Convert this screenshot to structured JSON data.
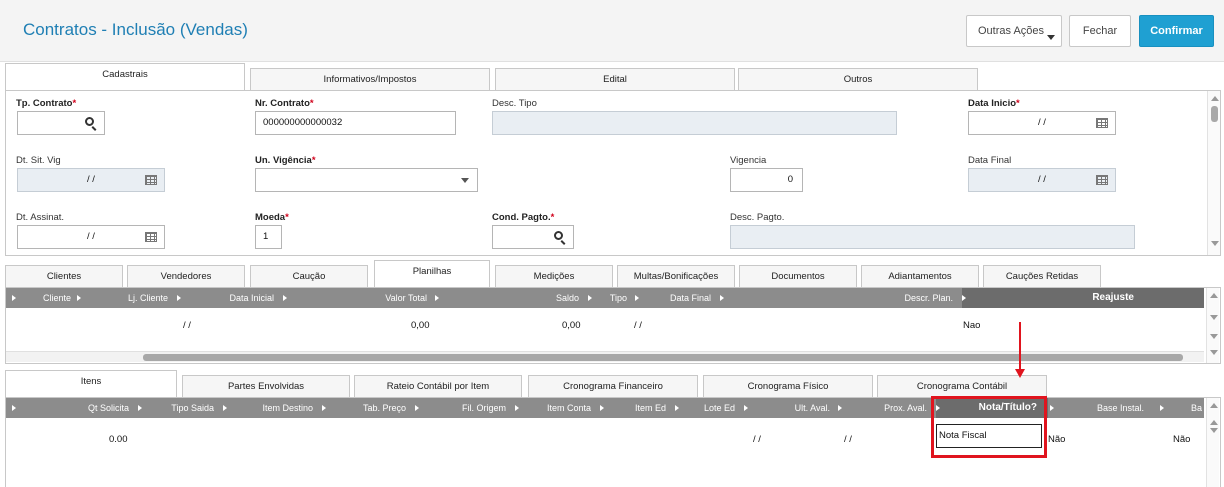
{
  "header": {
    "title": "Contratos - Inclusão (Vendas)",
    "buttons": {
      "outras": "Outras Ações",
      "fechar": "Fechar",
      "confirmar": "Confirmar"
    }
  },
  "top_tabs": [
    "Cadastrais",
    "Informativos/Impostos",
    "Edital",
    "Outros"
  ],
  "form": {
    "tp_contrato": {
      "label": "Tp. Contrato",
      "value": ""
    },
    "nr_contrato": {
      "label": "Nr. Contrato",
      "value": "000000000000032"
    },
    "desc_tipo": {
      "label": "Desc. Tipo",
      "value": ""
    },
    "data_inicio": {
      "label": "Data Inicio",
      "value": "/ /"
    },
    "dt_sit_vig": {
      "label": "Dt. Sit. Vig",
      "value": "/ /"
    },
    "un_vigencia": {
      "label": "Un. Vigência",
      "value": ""
    },
    "vigencia": {
      "label": "Vigencia",
      "value": "0"
    },
    "data_final": {
      "label": "Data Final",
      "value": "/ /"
    },
    "dt_assinat": {
      "label": "Dt. Assinat.",
      "value": "/ /"
    },
    "moeda": {
      "label": "Moeda",
      "value": "1"
    },
    "cond_pagto": {
      "label": "Cond. Pagto.",
      "value": ""
    },
    "desc_pagto": {
      "label": "Desc. Pagto.",
      "value": ""
    },
    "required_mark": "*"
  },
  "mid_tabs": [
    "Clientes",
    "Vendedores",
    "Caução",
    "Planilhas",
    "Medições",
    "Multas/Bonificações",
    "Documentos",
    "Adiantamentos",
    "Cauções Retidas"
  ],
  "planilhas_grid": {
    "columns": [
      "Cliente",
      "Lj. Cliente",
      "Data Inicial",
      "Valor Total",
      "Saldo",
      "Tipo",
      "Data Final",
      "Descr. Plan.",
      "Reajuste"
    ],
    "row": {
      "data_inicial": "/ /",
      "valor_total": "0,00",
      "saldo": "0,00",
      "data_final": "/ /",
      "reajuste": "Nao"
    }
  },
  "bottom_tabs": [
    "Itens",
    "Partes Envolvidas",
    "Rateio Contábil por Item",
    "Cronograma Financeiro",
    "Cronograma Físico",
    "Cronograma Contábil"
  ],
  "itens_grid": {
    "columns": [
      "Qt Solicita",
      "Tipo Saida",
      "Item Destino",
      "Tab. Preço",
      "Fil. Origem",
      "Item Conta",
      "Item Ed",
      "Lote Ed",
      "Ult. Aval.",
      "Prox. Aval.",
      "Nota/Título?",
      "Base Instal.",
      "Ba"
    ],
    "row": {
      "qt_solicita": "0.00",
      "ult_aval": "/ /",
      "prox_aval": "/ /",
      "nota_titulo": "Nota Fiscal",
      "base_instal": "Não",
      "ba": "Não"
    }
  },
  "colors": {
    "accent": "#1fa0d2",
    "title": "#1f7fb4",
    "annotation": "#e0141e",
    "grid_header": "#8c8c8c"
  }
}
